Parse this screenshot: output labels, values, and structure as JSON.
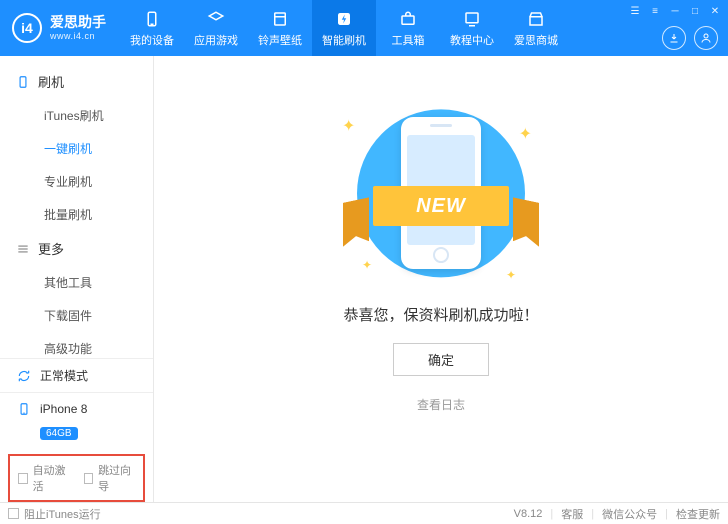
{
  "logo": {
    "badge": "i4",
    "name": "爱思助手",
    "url": "www.i4.cn"
  },
  "nav": {
    "items": [
      {
        "label": "我的设备",
        "icon": "device-icon"
      },
      {
        "label": "应用游戏",
        "icon": "apps-icon"
      },
      {
        "label": "铃声壁纸",
        "icon": "ringtone-icon"
      },
      {
        "label": "智能刷机",
        "icon": "flash-icon",
        "active": true
      },
      {
        "label": "工具箱",
        "icon": "toolbox-icon"
      },
      {
        "label": "教程中心",
        "icon": "tutorial-icon"
      },
      {
        "label": "爱思商城",
        "icon": "store-icon"
      }
    ]
  },
  "sidebar": {
    "group1": {
      "title": "刷机",
      "items": [
        "iTunes刷机",
        "一键刷机",
        "专业刷机",
        "批量刷机"
      ],
      "active_index": 1
    },
    "group2": {
      "title": "更多",
      "items": [
        "其他工具",
        "下载固件",
        "高级功能"
      ]
    },
    "mode": "正常模式",
    "device": {
      "name": "iPhone 8",
      "capacity": "64GB"
    },
    "checks": {
      "auto_activate": "自动激活",
      "skip_wizard": "跳过向导"
    }
  },
  "main": {
    "ribbon_text": "NEW",
    "success": "恭喜您，保资料刷机成功啦！",
    "ok": "确定",
    "view_log": "查看日志"
  },
  "statusbar": {
    "block_itunes": "阻止iTunes运行",
    "version": "V8.12",
    "support": "客服",
    "wechat": "微信公众号",
    "check_update": "检查更新"
  }
}
